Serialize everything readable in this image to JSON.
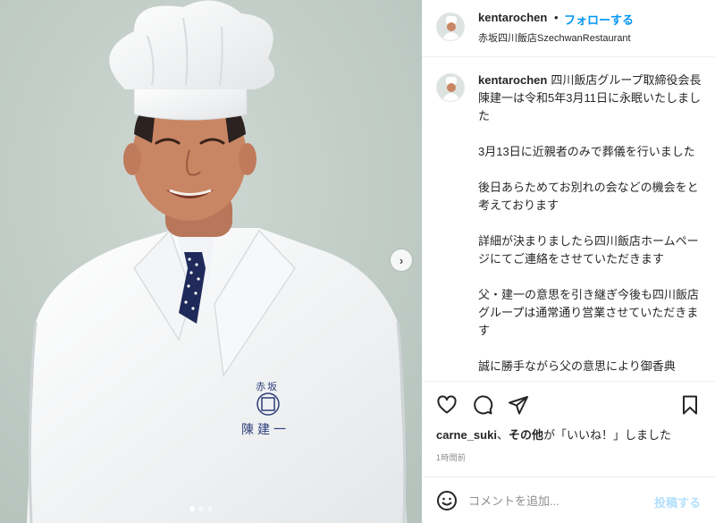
{
  "post": {
    "username": "kentarochen",
    "separator": "•",
    "follow_label": "フォローする",
    "location": "赤坂四川飯店SzechwanRestaurant"
  },
  "photo": {
    "badge_top": "赤坂",
    "badge_name": "陳建一"
  },
  "caption": {
    "username": "kentarochen",
    "lines": [
      "四川飯店グループ取締役会長 陳建一は令和5年3月11日に永眠いたしました",
      "3月13日に近親者のみで葬儀を行いました",
      "後日あらためてお別れの会などの機会をと考えております",
      "詳細が決まりましたら四川飯店ホームページにてご連絡をさせていただきます",
      "父・建一の意思を引き継ぎ今後も四川飯店グループは通常通り営業させていただきます",
      "誠に勝手ながら父の意思により御香典"
    ]
  },
  "likes": {
    "user": "carne_suki",
    "connector": "、",
    "others": "その他",
    "suffix": "が「いいね！」しました"
  },
  "timestamp": "1時間前",
  "comment": {
    "placeholder": "コメントを追加...",
    "post_label": "投稿する"
  },
  "icons": {
    "like": "heart-icon",
    "comment": "comment-icon",
    "share": "share-icon",
    "save": "bookmark-icon",
    "emoji": "emoji-icon",
    "next": "chevron-right-icon"
  },
  "colors": {
    "follow": "#0095f6",
    "post_disabled": "#b2dffc",
    "muted": "#8e8e8e"
  }
}
